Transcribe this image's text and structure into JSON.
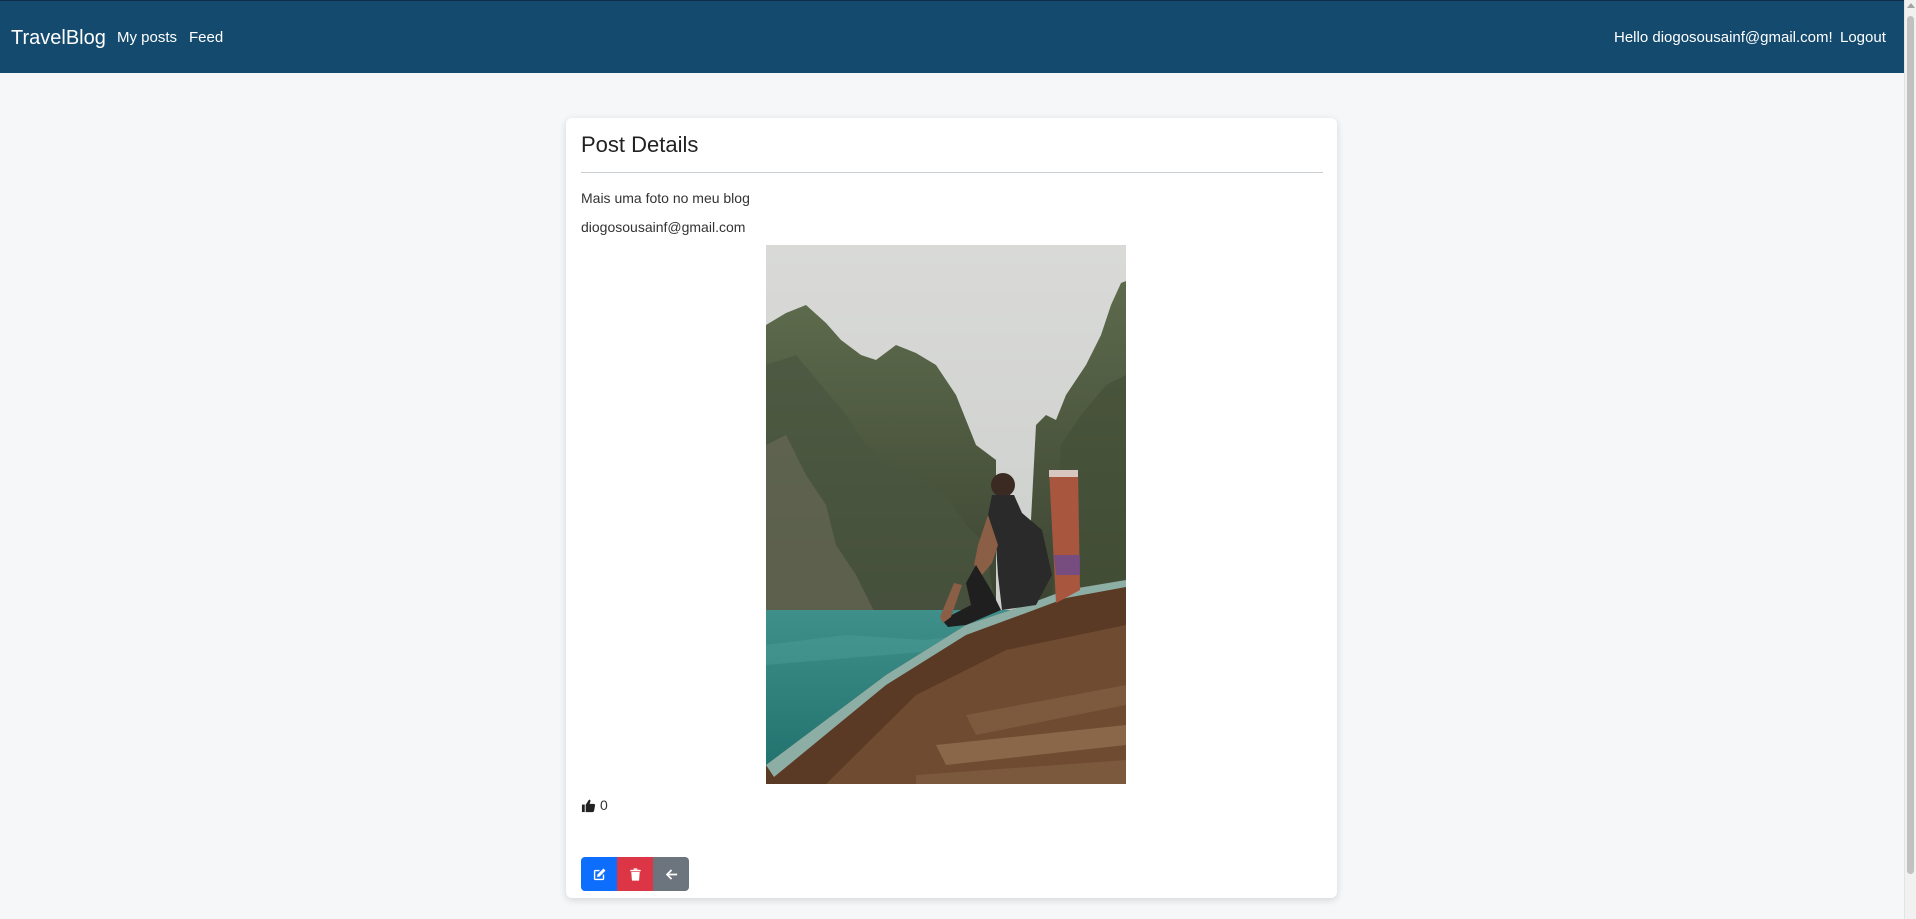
{
  "navbar": {
    "brand": "TravelBlog",
    "links": {
      "my_posts": "My posts",
      "feed": "Feed"
    },
    "greeting": "Hello diogosousainf@gmail.com!",
    "logout": "Logout",
    "background_color": "#134a6e"
  },
  "card": {
    "title": "Post Details",
    "caption": "Mais uma foto no meu blog",
    "author": "diogosousainf@gmail.com",
    "image_subject": "Person sitting on the bow of a wooden longtail boat among green limestone cliffs and turquoise water",
    "likes": {
      "icon": "thumbs-up-icon",
      "count": "0"
    }
  },
  "actions": {
    "edit": {
      "icon": "edit-icon",
      "color": "#0d6efd"
    },
    "delete": {
      "icon": "trash-icon",
      "color": "#dc3545"
    },
    "back": {
      "icon": "arrow-left-icon",
      "color": "#6c757d"
    }
  }
}
